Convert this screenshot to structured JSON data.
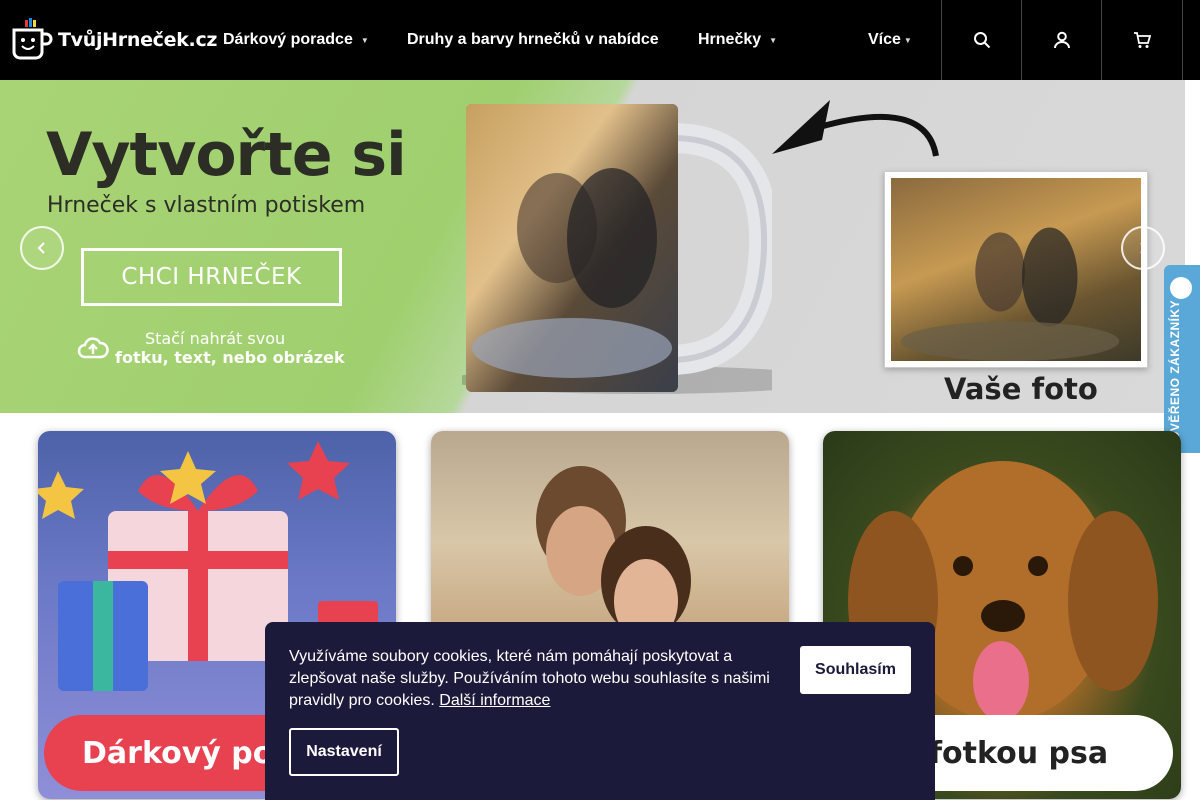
{
  "header": {
    "logo_text": "TvůjHrneček.cz",
    "nav": [
      {
        "label": "Dárkový poradce",
        "has_dropdown": true
      },
      {
        "label": "Druhy a barvy hrnečků v nabídce",
        "has_dropdown": false
      },
      {
        "label": "Hrnečky",
        "has_dropdown": true
      },
      {
        "label": "Více",
        "has_dropdown": true
      }
    ],
    "icons": [
      "search-icon",
      "user-icon",
      "cart-icon"
    ]
  },
  "hero": {
    "title": "Vytvořte si",
    "subtitle": "Hrneček s vlastním potiskem",
    "cta": "CHCI HRNEČEK",
    "upload_line1": "Stačí nahrát svou",
    "upload_line2": "fotku, text, nebo obrázek",
    "photo_label": "Vaše foto"
  },
  "trust_badge": {
    "text": "OVĚŘENO ZÁKAZNÍKY"
  },
  "cards": [
    {
      "label": "Dárkový po"
    },
    {
      "label": ""
    },
    {
      "label": "fotkou psa"
    }
  ],
  "cookie": {
    "text": "Využíváme soubory cookies, které nám pomáhají poskytovat a zlepšovat naše služby. Používáním tohoto webu souhlasíte s našimi pravidly pro cookies.",
    "link": "Další informace",
    "accept": "Souhlasím",
    "settings": "Nastavení"
  },
  "colors": {
    "header_bg": "#000000",
    "cookie_bg": "#1b1a3a",
    "pill_red": "#e8414f",
    "trust_blue": "#5aa8d8"
  }
}
